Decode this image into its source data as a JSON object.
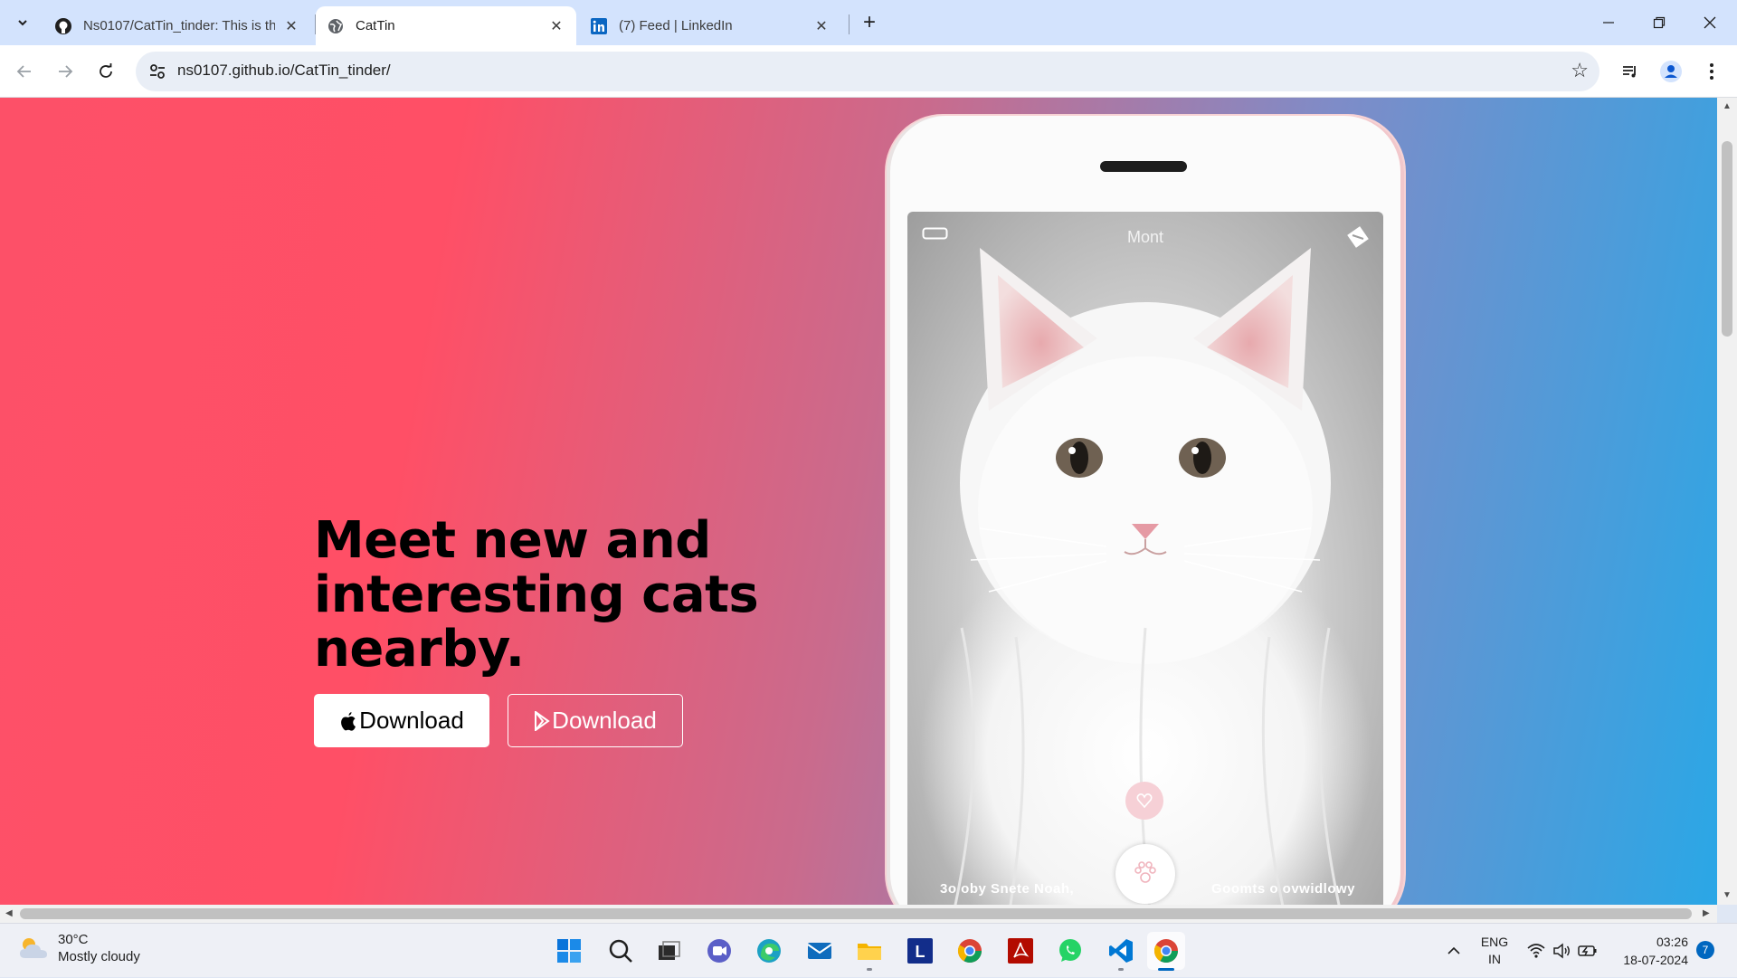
{
  "browser": {
    "tabs": [
      {
        "title": "Ns0107/CatTin_tinder: This is th",
        "icon": "github-icon",
        "active": false
      },
      {
        "title": "CatTin",
        "icon": "globe-icon",
        "active": true
      },
      {
        "title": "(7) Feed | LinkedIn",
        "icon": "linkedin-icon",
        "active": false
      }
    ],
    "url": "ns0107.github.io/CatTin_tinder/"
  },
  "page": {
    "headline": "Meet new and interesting cats nearby.",
    "buttons": {
      "ios_label": "Download",
      "android_label": "Download"
    },
    "phone": {
      "profile_name": "Mont",
      "caption_left": "3o oby Snete Noah,",
      "caption_right": "Goomts o ovwidlowy"
    },
    "colors": {
      "gradient_start": "#fd5068",
      "gradient_end": "#2aa7e6"
    }
  },
  "taskbar": {
    "weather": {
      "temp": "30°C",
      "condition": "Mostly cloudy"
    },
    "apps": [
      "start-icon",
      "search-icon",
      "task-view-icon",
      "teams-icon",
      "edge-icon",
      "mail-icon",
      "file-explorer-icon",
      "l-app-icon",
      "chrome-icon",
      "acrobat-icon",
      "whatsapp-icon",
      "vscode-icon",
      "chrome-active-icon"
    ],
    "lang": {
      "line1": "ENG",
      "line2": "IN"
    },
    "time": "03:26",
    "date": "18-07-2024",
    "notification_count": "7"
  }
}
